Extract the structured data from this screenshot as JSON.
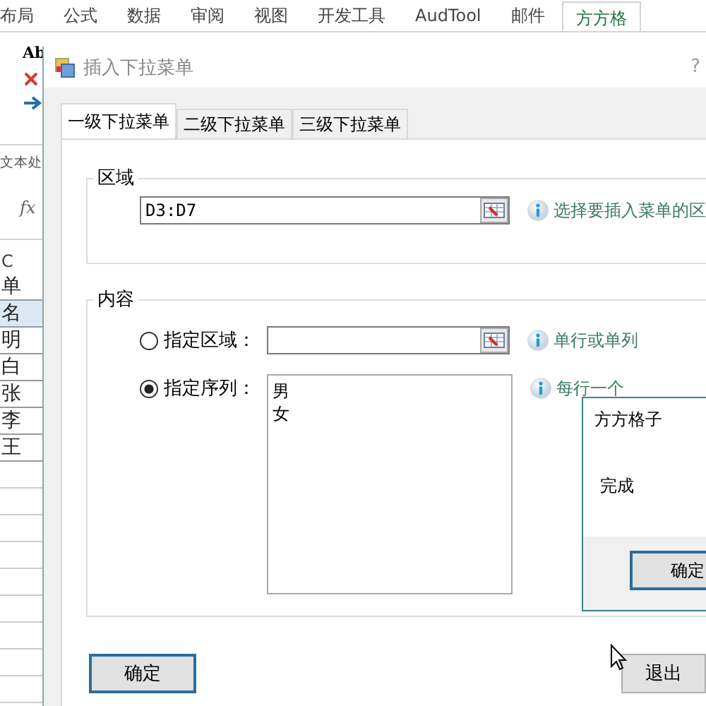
{
  "ribbon_tabs": [
    {
      "label": "布局",
      "selected": false
    },
    {
      "label": "公式",
      "selected": false
    },
    {
      "label": "数据",
      "selected": false
    },
    {
      "label": "审阅",
      "selected": false
    },
    {
      "label": "视图",
      "selected": false
    },
    {
      "label": "开发工具",
      "selected": false
    },
    {
      "label": "AudTool",
      "selected": false
    },
    {
      "label": "邮件",
      "selected": false
    },
    {
      "label": "方方格",
      "selected": true
    }
  ],
  "ribbon": {
    "button_label": "Ab",
    "group_label": "文本处"
  },
  "formula_bar": {
    "fx": "fx"
  },
  "sheet": {
    "column": "C",
    "cells": [
      {
        "text": "单",
        "selected": false
      },
      {
        "text": "名",
        "selected": true
      },
      {
        "text": "明",
        "selected": false
      },
      {
        "text": "白",
        "selected": false
      },
      {
        "text": "张",
        "selected": false
      },
      {
        "text": "李",
        "selected": false
      },
      {
        "text": "王",
        "selected": false
      }
    ]
  },
  "dialog": {
    "title": "插入下拉菜单",
    "help": "?",
    "tabs": [
      {
        "label": "一级下拉菜单",
        "selected": true
      },
      {
        "label": "二级下拉菜单",
        "selected": false
      },
      {
        "label": "三级下拉菜单",
        "selected": false
      }
    ],
    "groups": [
      {
        "title": "区域",
        "rows": [
          {
            "kind": "range",
            "value": "D3:D7",
            "hint": "选择要插入菜单的区"
          }
        ]
      },
      {
        "title": "内容",
        "rows": [
          {
            "kind": "radio_range",
            "label": "指定区域：",
            "selected": false,
            "hint": "单行或单列"
          },
          {
            "kind": "radio_list",
            "label": "指定序列：",
            "selected": true,
            "lines": [
              "男",
              "女"
            ],
            "hint": "每行一个"
          }
        ]
      }
    ],
    "buttons": [
      {
        "label": "确定",
        "default": true
      },
      {
        "label": "退出",
        "default": false
      }
    ]
  },
  "message_box": {
    "title": "方方格子",
    "message": "完成",
    "button": "确定"
  }
}
